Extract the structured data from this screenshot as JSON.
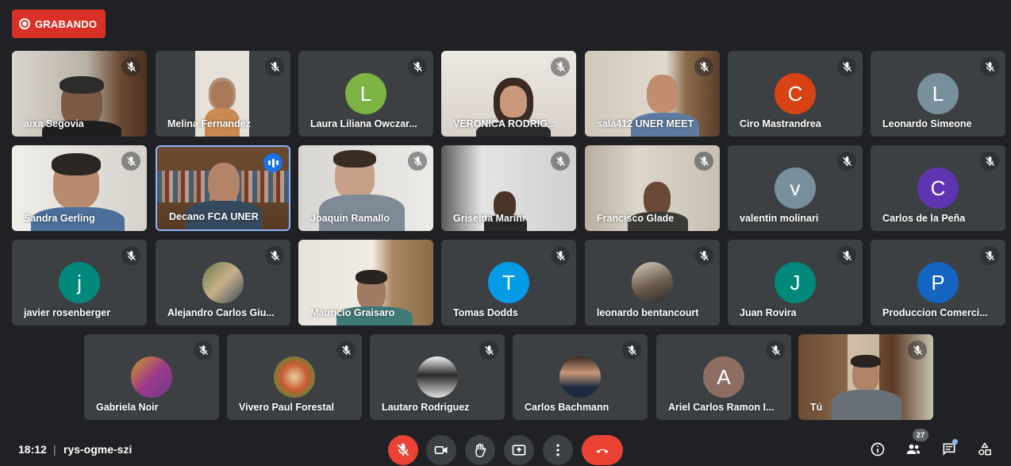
{
  "recording": {
    "label": "GRABANDO"
  },
  "participants": [
    {
      "name": "aixa Segovia"
    },
    {
      "name": "Melina Fernandez"
    },
    {
      "name": "Laura Liliana Owczar...",
      "initial": "L",
      "color": "#7cb342"
    },
    {
      "name": "VERONICA RODRIG..."
    },
    {
      "name": "sala412 UNER MEET"
    },
    {
      "name": "Ciro Mastrandrea",
      "initial": "C",
      "color": "#d84315"
    },
    {
      "name": "Leonardo Simeone",
      "initial": "L",
      "color": "#78909c"
    },
    {
      "name": "Sandra Gerling"
    },
    {
      "name": "Decano FCA UNER"
    },
    {
      "name": "Joaquin Ramallo"
    },
    {
      "name": "Griselda Marini"
    },
    {
      "name": "Francisco Glade"
    },
    {
      "name": "valentin molinari",
      "initial": "v",
      "color": "#78909c"
    },
    {
      "name": "Carlos de la Peña",
      "initial": "C",
      "color": "#5e35b1"
    },
    {
      "name": "javier rosenberger",
      "initial": "j",
      "color": "#00897b"
    },
    {
      "name": "Alejandro Carlos Giu..."
    },
    {
      "name": "Mauricio Graisaro"
    },
    {
      "name": "Tomas Dodds",
      "initial": "T",
      "color": "#039be5"
    },
    {
      "name": "leonardo bentancourt"
    },
    {
      "name": "Juan Rovira",
      "initial": "J",
      "color": "#00897b"
    },
    {
      "name": "Produccion Comerci...",
      "initial": "P",
      "color": "#1565c0"
    },
    {
      "name": "Gabriela Noir"
    },
    {
      "name": "Vivero Paul Forestal"
    },
    {
      "name": "Lautaro Rodriguez"
    },
    {
      "name": "Carlos Bachmann"
    },
    {
      "name": "Ariel Carlos Ramon I...",
      "initial": "A",
      "color": "#8d6e63"
    },
    {
      "name": "Tú"
    }
  ],
  "bottom_bar": {
    "time": "18:12",
    "separator": "|",
    "meeting_code": "rys-ogme-szi",
    "participant_count": "27"
  }
}
